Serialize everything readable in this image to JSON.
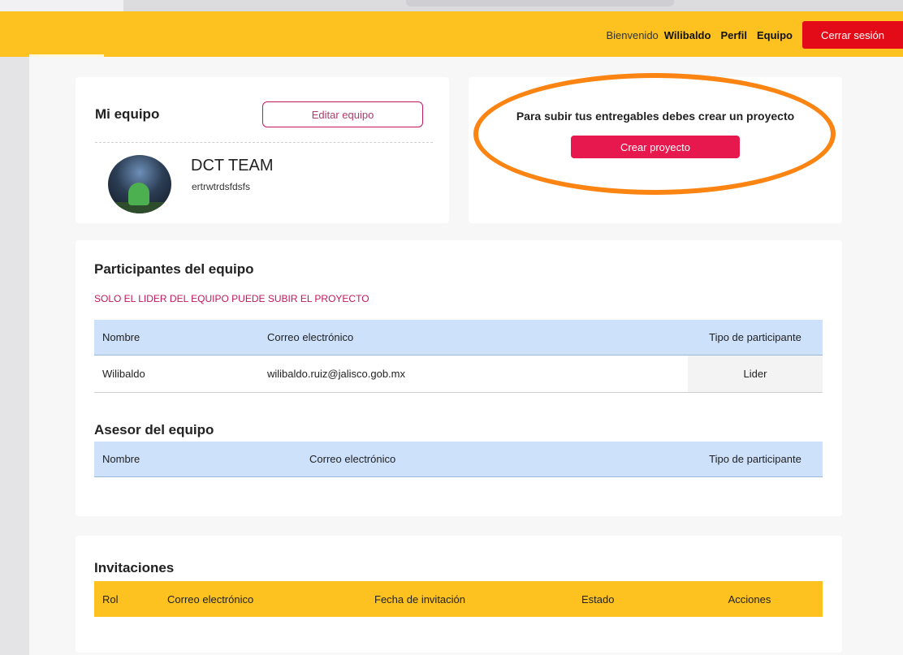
{
  "nav": {
    "welcome": "Bienvenido",
    "user": "Wilibaldo",
    "profile": "Perfil",
    "team": "Equipo",
    "logout": "Cerrar sesión"
  },
  "team_card": {
    "title": "Mi equipo",
    "edit_button": "Editar equipo",
    "team_name": "DCT TEAM",
    "team_description": "ertrwtrdsfdsfs"
  },
  "project_card": {
    "message": "Para subir tus entregables debes crear un proyecto",
    "create_button": "Crear proyecto"
  },
  "members": {
    "title": "Participantes del equipo",
    "warning": "SOLO EL LIDER DEL EQUIPO PUEDE SUBIR EL PROYECTO",
    "headers": {
      "name": "Nombre",
      "email": "Correo electrónico",
      "type": "Tipo de participante"
    },
    "rows": [
      {
        "name": "Wilibaldo",
        "email": "wilibaldo.ruiz@jalisco.gob.mx",
        "type": "Lider"
      }
    ]
  },
  "advisors": {
    "title": "Asesor del equipo",
    "headers": {
      "name": "Nombre",
      "email": "Correo electrónico",
      "type": "Tipo de participante"
    }
  },
  "invitations": {
    "title": "Invitaciones",
    "headers": {
      "role": "Rol",
      "email": "Correo electrónico",
      "date": "Fecha de invitación",
      "status": "Estado",
      "actions": "Acciones"
    }
  },
  "colors": {
    "navbar": "#fdc21f",
    "logout": "#e30b17",
    "primary_button": "#e6184d",
    "table_header_blue": "#cde1fb",
    "highlight": "#fb8412"
  }
}
